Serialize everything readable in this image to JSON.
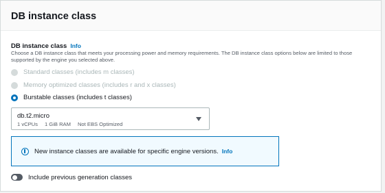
{
  "panel": {
    "title": "DB instance class"
  },
  "field": {
    "label": "DB instance class",
    "info_link": "Info",
    "description": "Choose a DB instance class that meets your processing power and memory requirements. The DB instance class options below are limited to those supported by the engine you selected above."
  },
  "radio_options": [
    {
      "label": "Standard classes (includes m classes)",
      "state": "disabled"
    },
    {
      "label": "Memory optimized classes (includes r and x classes)",
      "state": "disabled"
    },
    {
      "label": "Burstable classes (includes t classes)",
      "state": "selected"
    }
  ],
  "instance_select": {
    "value": "db.t2.micro",
    "vcpus": "1 vCPUs",
    "ram": "1 GiB RAM",
    "ebs": "Not EBS Optimized",
    "icon": "caret-down-icon"
  },
  "alert": {
    "text": "New instance classes are available for specific engine versions.",
    "info_link": "Info",
    "icon": "info-circle-icon"
  },
  "toggle": {
    "label": "Include previous generation classes",
    "enabled": false
  },
  "colors": {
    "accent": "#0073bb",
    "alert_background": "#f1faff",
    "disabled_text": "#aab7b8",
    "text": "#16191f",
    "secondary_text": "#545b64"
  }
}
